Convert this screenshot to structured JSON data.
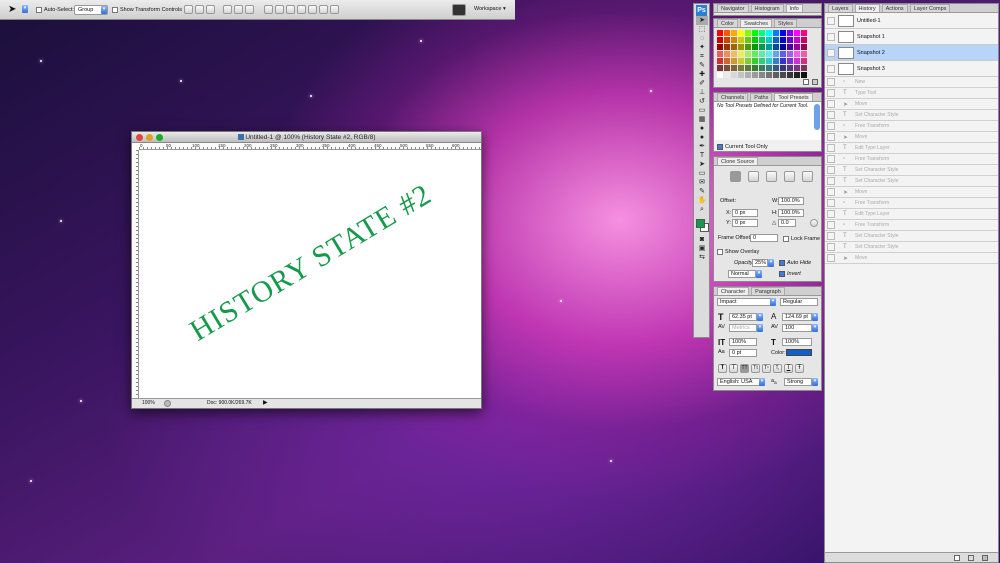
{
  "options_bar": {
    "auto_select_label": "Auto-Select:",
    "group_value": "Group",
    "show_transform_label": "Show Transform Controls",
    "workspace_label": "Workspace"
  },
  "document": {
    "title": "Untitled-1 @ 100% (History State #2, RGB/8)",
    "ruler_ticks": [
      "0",
      "50",
      "100",
      "150",
      "200",
      "250",
      "300",
      "350",
      "400",
      "450",
      "500",
      "550",
      "600"
    ],
    "canvas_text": "HISTORY STATE #2",
    "text_color": "#149a4a",
    "zoom": "100%",
    "doc_size": "Doc: 900.0K/269.7K"
  },
  "nav_panel": {
    "tabs": [
      "Navigator",
      "Histogram",
      "Info"
    ]
  },
  "swatches_panel": {
    "tabs": [
      "Color",
      "Swatches",
      "Styles"
    ]
  },
  "presets_panel": {
    "tabs": [
      "Channels",
      "Paths",
      "Tool Presets"
    ],
    "message": "No Tool Presets Defined for Current Tool.",
    "current_tool_only": "Current Tool Only"
  },
  "clone_panel": {
    "tab": "Clone Source",
    "offset_label": "Offset:",
    "x_label": "X:",
    "x_value": "0 px",
    "y_label": "Y:",
    "y_value": "0 px",
    "w_label": "W:",
    "w_value": "100.0%",
    "h_label": "H:",
    "h_value": "100.0%",
    "angle_value": "0.0",
    "frame_offset_label": "Frame Offset:",
    "frame_offset_value": "0",
    "lock_frame_label": "Lock Frame",
    "show_overlay_label": "Show Overlay",
    "opacity_label": "Opacity:",
    "opacity_value": "25%",
    "auto_hide_label": "Auto Hide",
    "blend_value": "Normal",
    "invert_label": "Invert"
  },
  "character_panel": {
    "tabs": [
      "Character",
      "Paragraph"
    ],
    "font_family": "Impact",
    "font_style": "Regular",
    "font_size": "62.35 pt",
    "leading": "124.69 pt",
    "kerning": "Metrics",
    "tracking": "100",
    "vscale": "100%",
    "hscale": "100%",
    "baseline": "0 pt",
    "color_label": "Color:",
    "color": "#1060c8",
    "style_buttons": [
      "T",
      "T",
      "TT",
      "Tt",
      "T¹",
      "T,",
      "T",
      "Ŧ"
    ],
    "language": "English: USA",
    "aa_label": "a",
    "antialias": "Strong"
  },
  "history_panel": {
    "tabs": [
      "Layers",
      "History",
      "Actions",
      "Layer Comps"
    ],
    "snapshots": [
      "Untitled-1",
      "Snapshot 1",
      "Snapshot 2",
      "Snapshot 3"
    ],
    "states": [
      "New",
      "Type Tool",
      "Move",
      "Set Character Style",
      "Free Transform",
      "Move",
      "Edit Type Layer",
      "Free Transform",
      "Set Character Style",
      "Set Character Style",
      "Move",
      "Free Transform",
      "Edit Type Layer",
      "Free Transform",
      "Set Character Style",
      "Set Character Style",
      "Move"
    ]
  },
  "toolbox": {
    "ps_label": "Ps"
  }
}
